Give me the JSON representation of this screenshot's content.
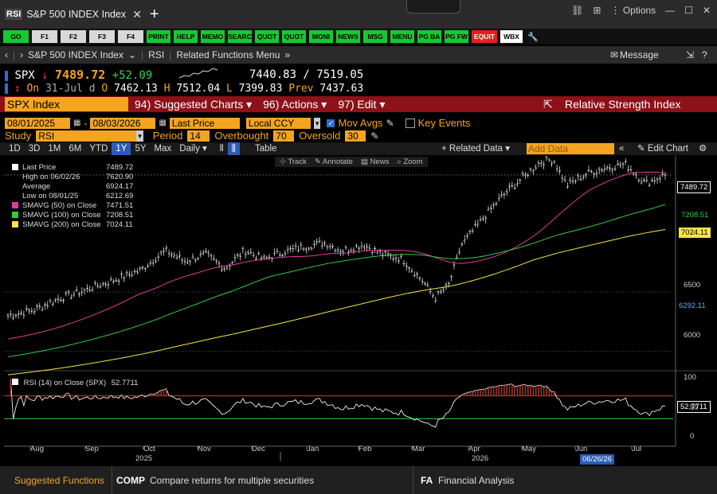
{
  "window": {
    "badge": "RSI",
    "title": "S&P 500 INDEX Index",
    "close": "✕",
    "new_tab": "+",
    "options": "Options"
  },
  "fkeys": [
    {
      "label": "GO",
      "color": "green",
      "w": 32
    },
    {
      "label": "F1",
      "color": "gray",
      "w": 32
    },
    {
      "label": "F2",
      "color": "gray",
      "w": 32
    },
    {
      "label": "F3",
      "color": "gray",
      "w": 32
    },
    {
      "label": "F4",
      "color": "gray",
      "w": 32
    },
    {
      "label": "PRINT",
      "color": "green",
      "w": 30
    },
    {
      "label": "HELP",
      "color": "green",
      "w": 30
    },
    {
      "label": "MEMO",
      "color": "green",
      "w": 30
    },
    {
      "label": "SEARC",
      "color": "green",
      "w": 30
    },
    {
      "label": "QUOT",
      "color": "green",
      "w": 30
    },
    {
      "label": "QUOT",
      "color": "green",
      "w": 30
    },
    {
      "label": "MONI",
      "color": "green",
      "w": 30
    },
    {
      "label": "NEWS",
      "color": "green",
      "w": 30
    },
    {
      "label": "MSG",
      "color": "green",
      "w": 30
    },
    {
      "label": "MENU",
      "color": "green",
      "w": 30
    },
    {
      "label": "PG BA",
      "color": "green",
      "w": 30
    },
    {
      "label": "PG FW",
      "color": "green",
      "w": 30
    },
    {
      "label": "EQUIT",
      "color": "red",
      "w": 32
    },
    {
      "label": "WBX",
      "color": "white",
      "w": 28
    }
  ],
  "breadcrumb": {
    "security": "S&P 500 INDEX Index",
    "function": "RSI",
    "related": "Related Functions Menu",
    "message": "Message"
  },
  "quote": {
    "ticker": "SPX",
    "last": "7489.72",
    "change": "+52.09",
    "bidask": "7440.83 / 7519.05",
    "line2_on": "On",
    "date": "31-Jul d",
    "o_lbl": "O",
    "open": "7462.13",
    "h_lbl": "H",
    "high": "7512.04",
    "l_lbl": "L",
    "low": "7399.83",
    "prev_lbl": "Prev",
    "prev": "7437.63"
  },
  "header": {
    "security": "SPX Index",
    "m1": "94) Suggested Charts",
    "m2": "96) Actions",
    "m3": "97) Edit",
    "title": "Relative Strength Index"
  },
  "settings": {
    "start": "08/01/2025",
    "end": "08/03/2026",
    "price": "Last Price",
    "ccy": "Local CCY",
    "mov_avgs": "Mov Avgs",
    "key_events": "Key Events",
    "study_lbl": "Study",
    "study": "RSI",
    "period_lbl": "Period",
    "period": "14",
    "overbought_lbl": "Overbought",
    "overbought": "70",
    "oversold_lbl": "Oversold",
    "oversold": "30"
  },
  "toolbar": {
    "ranges": [
      "1D",
      "3D",
      "1M",
      "6M",
      "YTD",
      "1Y",
      "5Y",
      "Max"
    ],
    "selected": "1Y",
    "freq": "Daily",
    "table": "Table",
    "related": "Related Data",
    "add_data_placeholder": "Add Data",
    "edit_chart": "Edit Chart"
  },
  "chart_tools": {
    "track": "Track",
    "annotate": "Annotate",
    "news": "News",
    "zoom": "Zoom"
  },
  "legend": [
    {
      "label": "Last Price",
      "value": "7489.72",
      "color": "#ffffff"
    },
    {
      "label": "High on 06/02/26",
      "value": "7620.90",
      "color": ""
    },
    {
      "label": "Average",
      "value": "6924.17",
      "color": ""
    },
    {
      "label": "Low on 08/01/25",
      "value": "6212.69",
      "color": ""
    },
    {
      "label": "SMAVG (50)  on Close",
      "value": "7471.51",
      "color": "#e23c9a"
    },
    {
      "label": "SMAVG (100)  on Close",
      "value": "7208.51",
      "color": "#2ecc40"
    },
    {
      "label": "SMAVG (200)  on Close",
      "value": "7024.11",
      "color": "#f5e642"
    }
  ],
  "rsi_legend": {
    "label": "RSI (14)  on Close (SPX)",
    "value": "52.7711"
  },
  "axis": {
    "price_ticks": [
      "6500",
      "6000"
    ],
    "rsi_ticks": [
      "100",
      "50",
      "0"
    ],
    "months": [
      "Aug",
      "Sep",
      "Oct",
      "Nov",
      "Dec",
      "Jan",
      "Feb",
      "Mar",
      "Apr",
      "May",
      "Jun",
      "Jul"
    ],
    "years": [
      "2025",
      "2026"
    ],
    "cursor_date": "06/26/26",
    "tags": {
      "last": "7489.72",
      "sma100": "7208.51",
      "sma200": "7024.11",
      "low": "6292.11",
      "rsi": "52.7711"
    }
  },
  "colors": {
    "sma50": "#e23c9a",
    "sma100": "#2ecc40",
    "sma200": "#f5e642",
    "rsi_bound": "#e03030",
    "rsi_low": "#2ecc40",
    "accent": "#f4a41e"
  },
  "footer": {
    "suggested": "Suggested Functions",
    "f1_code": "COMP",
    "f1_desc": "Compare returns for multiple securities",
    "f2_code": "FA",
    "f2_desc": "Financial Analysis"
  },
  "chart_data": {
    "type": "line",
    "x_range": [
      "08/01/2025",
      "08/03/2026"
    ],
    "y_range": [
      5850,
      7650
    ],
    "monthly_close_approx": {
      "x": [
        "Aug",
        "Sep",
        "Oct",
        "Nov",
        "Dec",
        "Jan",
        "Feb",
        "Mar",
        "Apr",
        "May",
        "Jun",
        "Jul"
      ],
      "price": [
        6350,
        6550,
        6840,
        6750,
        6890,
        6920,
        6850,
        6500,
        7050,
        7450,
        7550,
        7489.72
      ]
    },
    "series": [
      {
        "name": "Last Price",
        "value": 7489.72
      },
      {
        "name": "SMAVG (50)",
        "value": 7471.51
      },
      {
        "name": "SMAVG (100)",
        "value": 7208.51
      },
      {
        "name": "SMAVG (200)",
        "value": 7024.11
      },
      {
        "name": "RSI (14)",
        "value": 52.7711
      }
    ],
    "rsi_range": [
      0,
      100
    ],
    "rsi_overbought": 70,
    "rsi_oversold": 30
  }
}
